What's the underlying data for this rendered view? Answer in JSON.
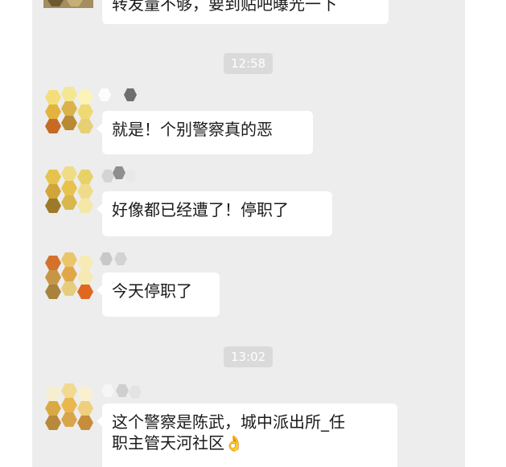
{
  "messages": [
    {
      "id": "m0",
      "text": "转发量不够，要到贴吧曝光一下"
    },
    {
      "id": "m1",
      "text": "就是！个别警察真的恶"
    },
    {
      "id": "m2",
      "text": "好像都已经遭了！停职了"
    },
    {
      "id": "m3",
      "text": "今天停职了"
    },
    {
      "id": "m4",
      "text_line1": "这个警察是陈武，城中派出所_任",
      "text_line2": "职主管天河社区",
      "emoji": "👌"
    }
  ],
  "timestamps": [
    "12:58",
    "13:02"
  ],
  "icons": {
    "avatar": "pixelated-avatar-icon",
    "nickname": "pixelated-nickname-icon"
  },
  "colors": {
    "chat_background": "#ededed",
    "bubble": "#ffffff",
    "timestamp_background": "#dadada",
    "timestamp_text": "#ffffff"
  }
}
